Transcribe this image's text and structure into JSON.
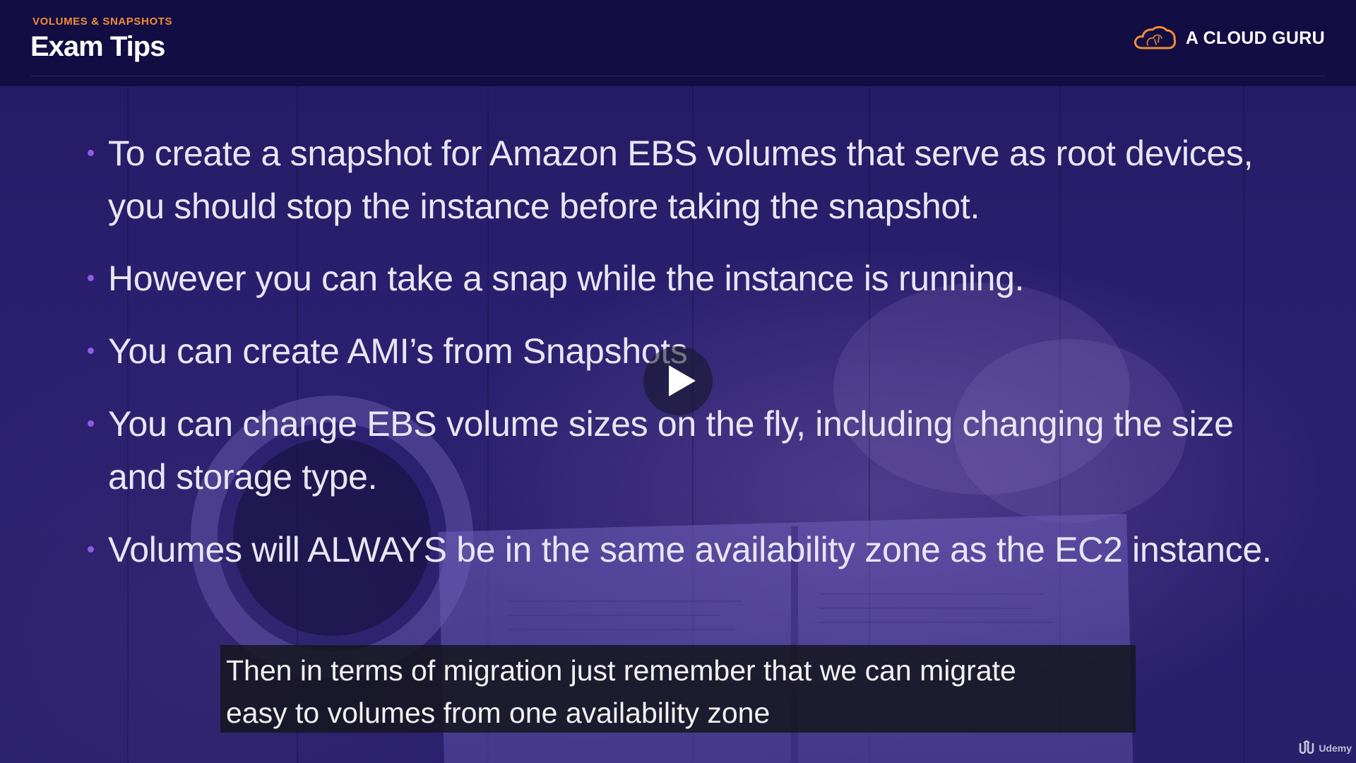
{
  "header": {
    "section_label": "VOLUMES & SNAPSHOTS",
    "title": "Exam Tips",
    "brand_name": "A CLOUD GURU",
    "brand_icon": "cloud-logo-icon",
    "accent_color": "#f08c3a"
  },
  "bullets": [
    {
      "text": "To create a snapshot for Amazon EBS volumes that serve as root devices, you should stop the instance before taking the snapshot."
    },
    {
      "text": "However you can take a snap while the instance is running."
    },
    {
      "text": "You can create AMI’s from Snapshots"
    },
    {
      "text": "You can change EBS volume sizes on the fly, including changing the size and storage type."
    },
    {
      "text": "Volumes will ALWAYS be in the same availability zone as the EC2 instance."
    }
  ],
  "bullet_color": "#8f5ce6",
  "player": {
    "play_icon": "play-icon"
  },
  "caption": {
    "line1": "Then in terms of migration just remember that we can migrate",
    "line2": "easy to volumes from one availability zone"
  },
  "watermark": {
    "text": "Udemy",
    "icon": "udemy-logo-icon"
  }
}
